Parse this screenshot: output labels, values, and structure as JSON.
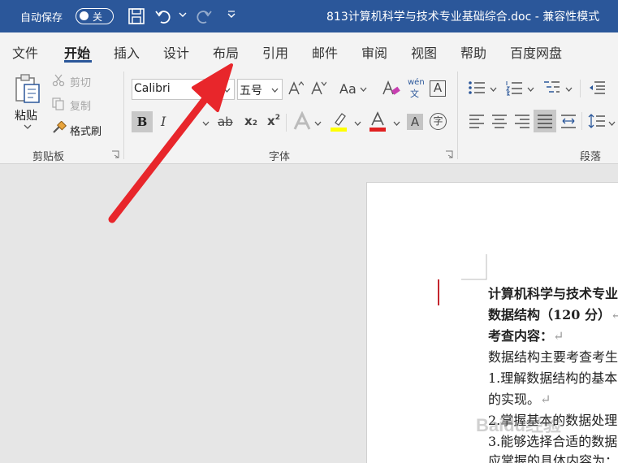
{
  "titlebar": {
    "autosave_label": "自动保存",
    "autosave_state": "关",
    "doc_title": "813计算机科学与技术专业基础综合.doc  -  兼容性模式"
  },
  "tabs": [
    "文件",
    "开始",
    "插入",
    "设计",
    "布局",
    "引用",
    "邮件",
    "审阅",
    "视图",
    "帮助",
    "百度网盘"
  ],
  "active_tab": "开始",
  "clipboard": {
    "paste": "粘贴",
    "cut": "剪切",
    "copy": "复制",
    "format_painter": "格式刷",
    "group_label": "剪贴板"
  },
  "font": {
    "font_name": "Calibri",
    "font_size": "五号",
    "group_label": "字体",
    "bold": "B",
    "italic": "I",
    "strike": "ab",
    "sub": "x",
    "sup": "x",
    "phonetic_top": "wén",
    "phonetic_bottom": "文",
    "aa": "Aa",
    "char_border": "A",
    "char_shade": "A",
    "enclose": "字"
  },
  "paragraph": {
    "group_label": "段落"
  },
  "colors": {
    "titlebar": "#2b579a",
    "ribbon": "#f3f3f3",
    "highlight": "#ffff00",
    "font_color": "#e02020",
    "arrow": "#e8262b"
  },
  "document": {
    "lines": [
      "计算机科学与技术专业",
      "数据结构（120 分）",
      "考查内容：",
      "数据结构主要考查考生",
      "1.理解数据结构的基本",
      "的实现。",
      "2.掌握基本的数据处理",
      "3.能够选择合适的数据",
      "应掌握的具体内容为："
    ]
  },
  "watermark": "Baidu经验"
}
